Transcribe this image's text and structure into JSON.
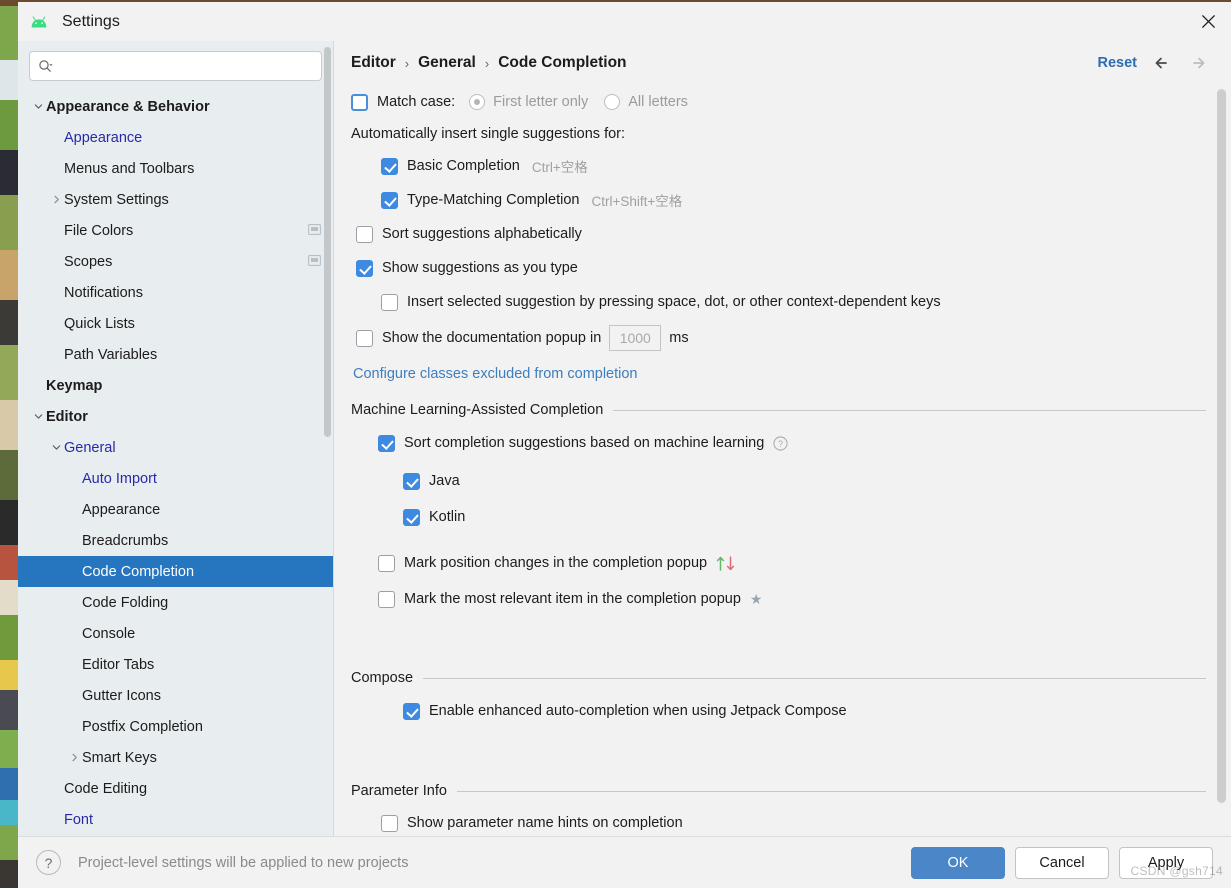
{
  "window": {
    "title": "Settings",
    "logo_icon": "android-logo-icon",
    "close_icon": "close-icon"
  },
  "sidebar": {
    "search": {
      "placeholder": "",
      "value": "",
      "icon": "search-icon"
    },
    "items": [
      {
        "label": "Appearance & Behavior",
        "indent": 0,
        "arrow": "down",
        "bold": true,
        "link": false,
        "selected": false,
        "trailing": null
      },
      {
        "label": "Appearance",
        "indent": 1,
        "arrow": null,
        "bold": false,
        "link": true,
        "selected": false,
        "trailing": null
      },
      {
        "label": "Menus and Toolbars",
        "indent": 1,
        "arrow": null,
        "bold": false,
        "link": false,
        "selected": false,
        "trailing": null
      },
      {
        "label": "System Settings",
        "indent": 1,
        "arrow": "right",
        "bold": false,
        "link": false,
        "selected": false,
        "trailing": null
      },
      {
        "label": "File Colors",
        "indent": 1,
        "arrow": null,
        "bold": false,
        "link": false,
        "selected": false,
        "trailing": "display-icon"
      },
      {
        "label": "Scopes",
        "indent": 1,
        "arrow": null,
        "bold": false,
        "link": false,
        "selected": false,
        "trailing": "display-icon"
      },
      {
        "label": "Notifications",
        "indent": 1,
        "arrow": null,
        "bold": false,
        "link": false,
        "selected": false,
        "trailing": null
      },
      {
        "label": "Quick Lists",
        "indent": 1,
        "arrow": null,
        "bold": false,
        "link": false,
        "selected": false,
        "trailing": null
      },
      {
        "label": "Path Variables",
        "indent": 1,
        "arrow": null,
        "bold": false,
        "link": false,
        "selected": false,
        "trailing": null
      },
      {
        "label": "Keymap",
        "indent": 0,
        "arrow": null,
        "bold": true,
        "link": false,
        "selected": false,
        "trailing": null
      },
      {
        "label": "Editor",
        "indent": 0,
        "arrow": "down",
        "bold": true,
        "link": false,
        "selected": false,
        "trailing": null
      },
      {
        "label": "General",
        "indent": 1,
        "arrow": "down",
        "bold": false,
        "link": true,
        "selected": false,
        "trailing": null
      },
      {
        "label": "Auto Import",
        "indent": 2,
        "arrow": null,
        "bold": false,
        "link": true,
        "selected": false,
        "trailing": null
      },
      {
        "label": "Appearance",
        "indent": 2,
        "arrow": null,
        "bold": false,
        "link": false,
        "selected": false,
        "trailing": null
      },
      {
        "label": "Breadcrumbs",
        "indent": 2,
        "arrow": null,
        "bold": false,
        "link": false,
        "selected": false,
        "trailing": null
      },
      {
        "label": "Code Completion",
        "indent": 2,
        "arrow": null,
        "bold": false,
        "link": false,
        "selected": true,
        "trailing": null
      },
      {
        "label": "Code Folding",
        "indent": 2,
        "arrow": null,
        "bold": false,
        "link": false,
        "selected": false,
        "trailing": null
      },
      {
        "label": "Console",
        "indent": 2,
        "arrow": null,
        "bold": false,
        "link": false,
        "selected": false,
        "trailing": null
      },
      {
        "label": "Editor Tabs",
        "indent": 2,
        "arrow": null,
        "bold": false,
        "link": false,
        "selected": false,
        "trailing": null
      },
      {
        "label": "Gutter Icons",
        "indent": 2,
        "arrow": null,
        "bold": false,
        "link": false,
        "selected": false,
        "trailing": null
      },
      {
        "label": "Postfix Completion",
        "indent": 2,
        "arrow": null,
        "bold": false,
        "link": false,
        "selected": false,
        "trailing": null
      },
      {
        "label": "Smart Keys",
        "indent": 2,
        "arrow": "right",
        "bold": false,
        "link": false,
        "selected": false,
        "trailing": null
      },
      {
        "label": "Code Editing",
        "indent": 1,
        "arrow": null,
        "bold": false,
        "link": false,
        "selected": false,
        "trailing": null
      },
      {
        "label": "Font",
        "indent": 1,
        "arrow": null,
        "bold": false,
        "link": true,
        "selected": false,
        "trailing": null
      }
    ]
  },
  "header": {
    "breadcrumb": [
      "Editor",
      "General",
      "Code Completion"
    ],
    "separator": "›",
    "reset_label": "Reset",
    "back_icon": "arrow-left-icon",
    "forward_icon": "arrow-right-icon"
  },
  "settings": {
    "match_case": {
      "label": "Match case:",
      "checked": false,
      "options": [
        {
          "label": "First letter only",
          "selected": true,
          "disabled": true
        },
        {
          "label": "All letters",
          "selected": false,
          "disabled": true
        }
      ]
    },
    "auto_insert_group_label": "Automatically insert single suggestions for:",
    "auto_insert_items": [
      {
        "label": "Basic Completion",
        "checked": true,
        "shortcut": "Ctrl+空格"
      },
      {
        "label": "Type-Matching Completion",
        "checked": true,
        "shortcut": "Ctrl+Shift+空格"
      }
    ],
    "sort_alphabetically": {
      "label": "Sort suggestions alphabetically",
      "checked": false
    },
    "show_as_you_type": {
      "label": "Show suggestions as you type",
      "checked": true
    },
    "insert_on_keys": {
      "label": "Insert selected suggestion by pressing space, dot, or other context-dependent keys",
      "checked": false
    },
    "doc_popup": {
      "label_before": "Show the documentation popup in",
      "value": "1000",
      "unit": "ms",
      "checked": false,
      "disabled": true
    },
    "excluded_link": "Configure classes excluded from completion",
    "ml_section": {
      "title": "Machine Learning-Assisted Completion",
      "sort_ml": {
        "label": "Sort completion suggestions based on machine learning",
        "checked": true,
        "help_icon": "help-circle-icon"
      },
      "languages": [
        {
          "label": "Java",
          "checked": true
        },
        {
          "label": "Kotlin",
          "checked": true
        }
      ],
      "mark_position": {
        "label": "Mark position changes in the completion popup",
        "checked": false,
        "icons": "arrows-up-down-icon"
      },
      "mark_relevant": {
        "label": "Mark the most relevant item in the completion popup",
        "checked": false,
        "icon": "star-icon"
      }
    },
    "compose_section": {
      "title": "Compose",
      "enable_compose": {
        "label": "Enable enhanced auto-completion when using Jetpack Compose",
        "checked": true
      }
    },
    "parameter_info_section": {
      "title": "Parameter Info",
      "show_hints": {
        "label": "Show parameter name hints on completion",
        "checked": false
      }
    }
  },
  "footer": {
    "help_icon": "help-icon",
    "note": "Project-level settings will be applied to new projects",
    "ok_label": "OK",
    "cancel_label": "Cancel",
    "apply_label": "Apply"
  },
  "watermark": "CSDN @gsh714",
  "colors": {
    "accent_blue": "#3d8ae0",
    "selection_blue": "#2675bf",
    "primary_button": "#4a86c8",
    "link_blue": "#2a6db5",
    "tree_link": "#2a2aa8"
  }
}
